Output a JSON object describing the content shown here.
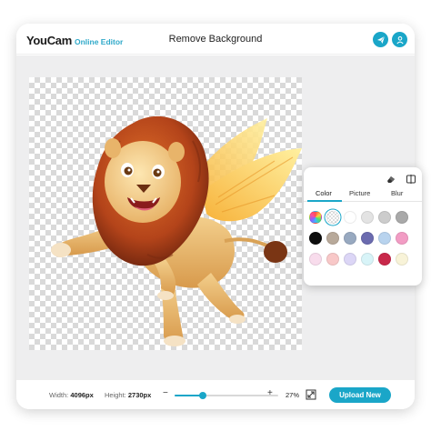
{
  "header": {
    "brand": "YouCam",
    "brand_sub": "Online Editor",
    "title": "Remove Background",
    "share_icon": "paper-plane-icon",
    "account_icon": "user-icon"
  },
  "panel": {
    "tools": [
      "eraser-icon",
      "compare-icon"
    ],
    "tabs": [
      {
        "label": "Color",
        "active": true
      },
      {
        "label": "Picture",
        "active": false
      },
      {
        "label": "Blur",
        "active": false
      }
    ],
    "swatches": [
      {
        "name": "color-picker",
        "color": "picker"
      },
      {
        "name": "transparent",
        "color": "none",
        "selected": true
      },
      {
        "name": "white",
        "color": "#ffffff"
      },
      {
        "name": "light-gray",
        "color": "#e3e3e3"
      },
      {
        "name": "gray",
        "color": "#cccccc"
      },
      {
        "name": "mid-gray",
        "color": "#a9a9a9"
      },
      {
        "name": "black",
        "color": "#0d0d0d"
      },
      {
        "name": "taupe",
        "color": "#b8a99a"
      },
      {
        "name": "steel-blue",
        "color": "#98a9c0"
      },
      {
        "name": "indigo",
        "color": "#6b6baf"
      },
      {
        "name": "sky-blue",
        "color": "#b8d3ee"
      },
      {
        "name": "pink",
        "color": "#f29cc4"
      },
      {
        "name": "blush",
        "color": "#f8dcec"
      },
      {
        "name": "peach",
        "color": "#f8c8c8"
      },
      {
        "name": "lavender",
        "color": "#dcd6f6"
      },
      {
        "name": "pale-aqua",
        "color": "#d8f4f8"
      },
      {
        "name": "crimson",
        "color": "#c8284a"
      },
      {
        "name": "cream",
        "color": "#f8f3d8"
      }
    ]
  },
  "footer": {
    "width_label": "Width:",
    "width_value": "4096px",
    "height_label": "Height:",
    "height_value": "2730px",
    "zoom_minus": "−",
    "zoom_plus": "+",
    "zoom_level": 0.27,
    "zoom_text": "27%",
    "fit_icon": "fit-screen-icon",
    "upload_label": "Upload New"
  },
  "colors": {
    "accent": "#1aa6c8"
  }
}
